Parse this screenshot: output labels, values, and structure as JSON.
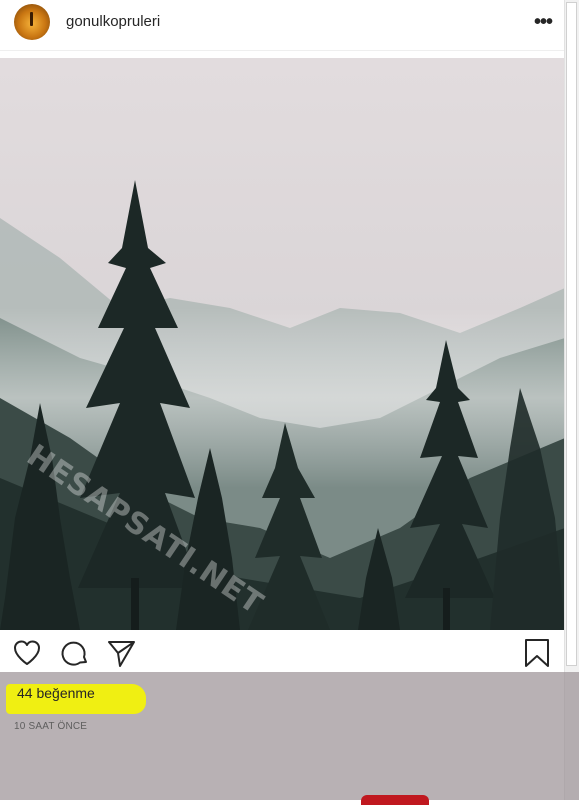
{
  "post": {
    "username": "gonulkopruleri",
    "more_icon": "more-horizontal-icon",
    "more_glyph": "•••",
    "watermark": "HESAPSATI.NET",
    "likes": "44 beğenme",
    "time": "10 SAAT ÖNCE"
  },
  "actions": {
    "like": "heart-icon",
    "comment": "comment-icon",
    "share": "send-icon",
    "save": "bookmark-icon"
  },
  "colors": {
    "highlight": "#f2f20a",
    "overlay": "#968c91",
    "tab_red": "#c0181f"
  }
}
